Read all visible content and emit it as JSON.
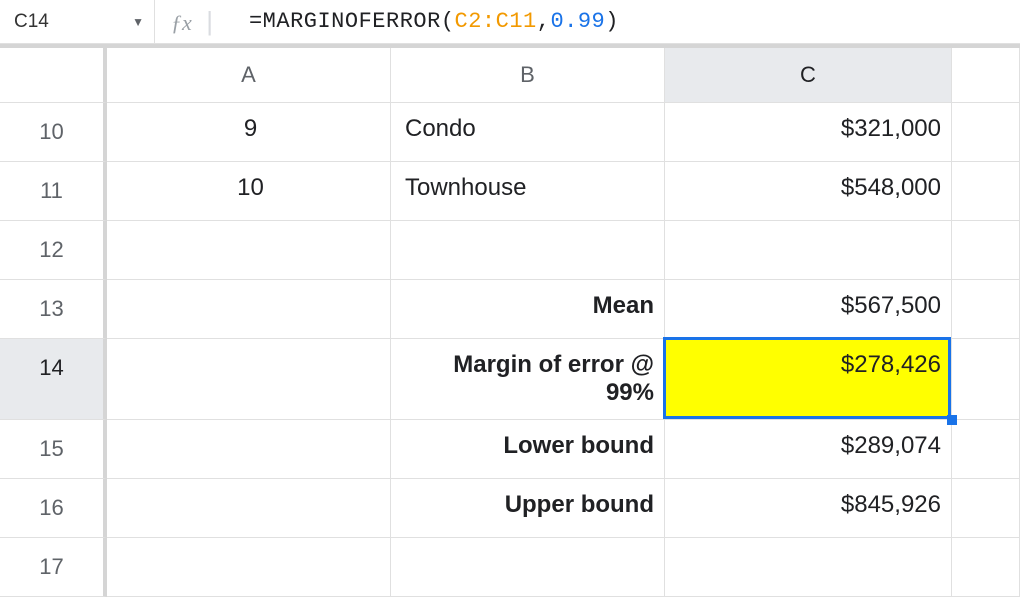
{
  "name_box": "C14",
  "formula": {
    "eq": "=",
    "fn": "MARGINOFERROR",
    "open": "(",
    "ref": "C2:C11",
    "comma": ",",
    "num": "0.99",
    "close": ")"
  },
  "columns": [
    "A",
    "B",
    "C"
  ],
  "rows": [
    {
      "num": "10",
      "a": "9",
      "b": "Condo",
      "c": "$321,000",
      "b_bold": false
    },
    {
      "num": "11",
      "a": "10",
      "b": "Townhouse",
      "c": "$548,000",
      "b_bold": false
    },
    {
      "num": "12",
      "a": "",
      "b": "",
      "c": "",
      "b_bold": false
    },
    {
      "num": "13",
      "a": "",
      "b": "Mean",
      "c": "$567,500",
      "b_bold": true
    },
    {
      "num": "14",
      "a": "",
      "b": "Margin of error @ 99%",
      "c": "$278,426",
      "b_bold": true,
      "selected": true
    },
    {
      "num": "15",
      "a": "",
      "b": "Lower bound",
      "c": "$289,074",
      "b_bold": true
    },
    {
      "num": "16",
      "a": "",
      "b": "Upper bound",
      "c": "$845,926",
      "b_bold": true
    },
    {
      "num": "17",
      "a": "",
      "b": "",
      "c": "",
      "b_bold": false
    }
  ],
  "selected_col": "C",
  "selected_row_index": 4
}
